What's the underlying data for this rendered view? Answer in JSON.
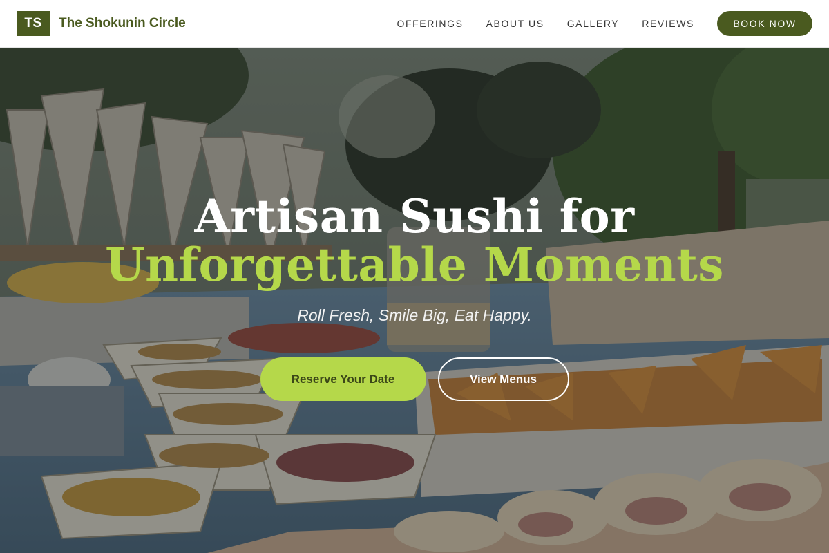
{
  "brand": {
    "initials": "TS",
    "name": "The Shokunin Circle"
  },
  "nav": {
    "links": [
      "OFFERINGS",
      "ABOUT US",
      "GALLERY",
      "REVIEWS"
    ],
    "cta": "BOOK NOW"
  },
  "hero": {
    "headline_line1": "Artisan Sushi for",
    "headline_line2": "Unforgettable Moments",
    "tagline": "Roll Fresh, Smile Big, Eat Happy.",
    "primary_cta": "Reserve Your Date",
    "secondary_cta": "View Menus",
    "image_description": "Outdoor catering buffet table with snacks, paper cones and flowers"
  },
  "colors": {
    "brand_green": "#4a5a1f",
    "accent_lime": "#b5d84a"
  }
}
